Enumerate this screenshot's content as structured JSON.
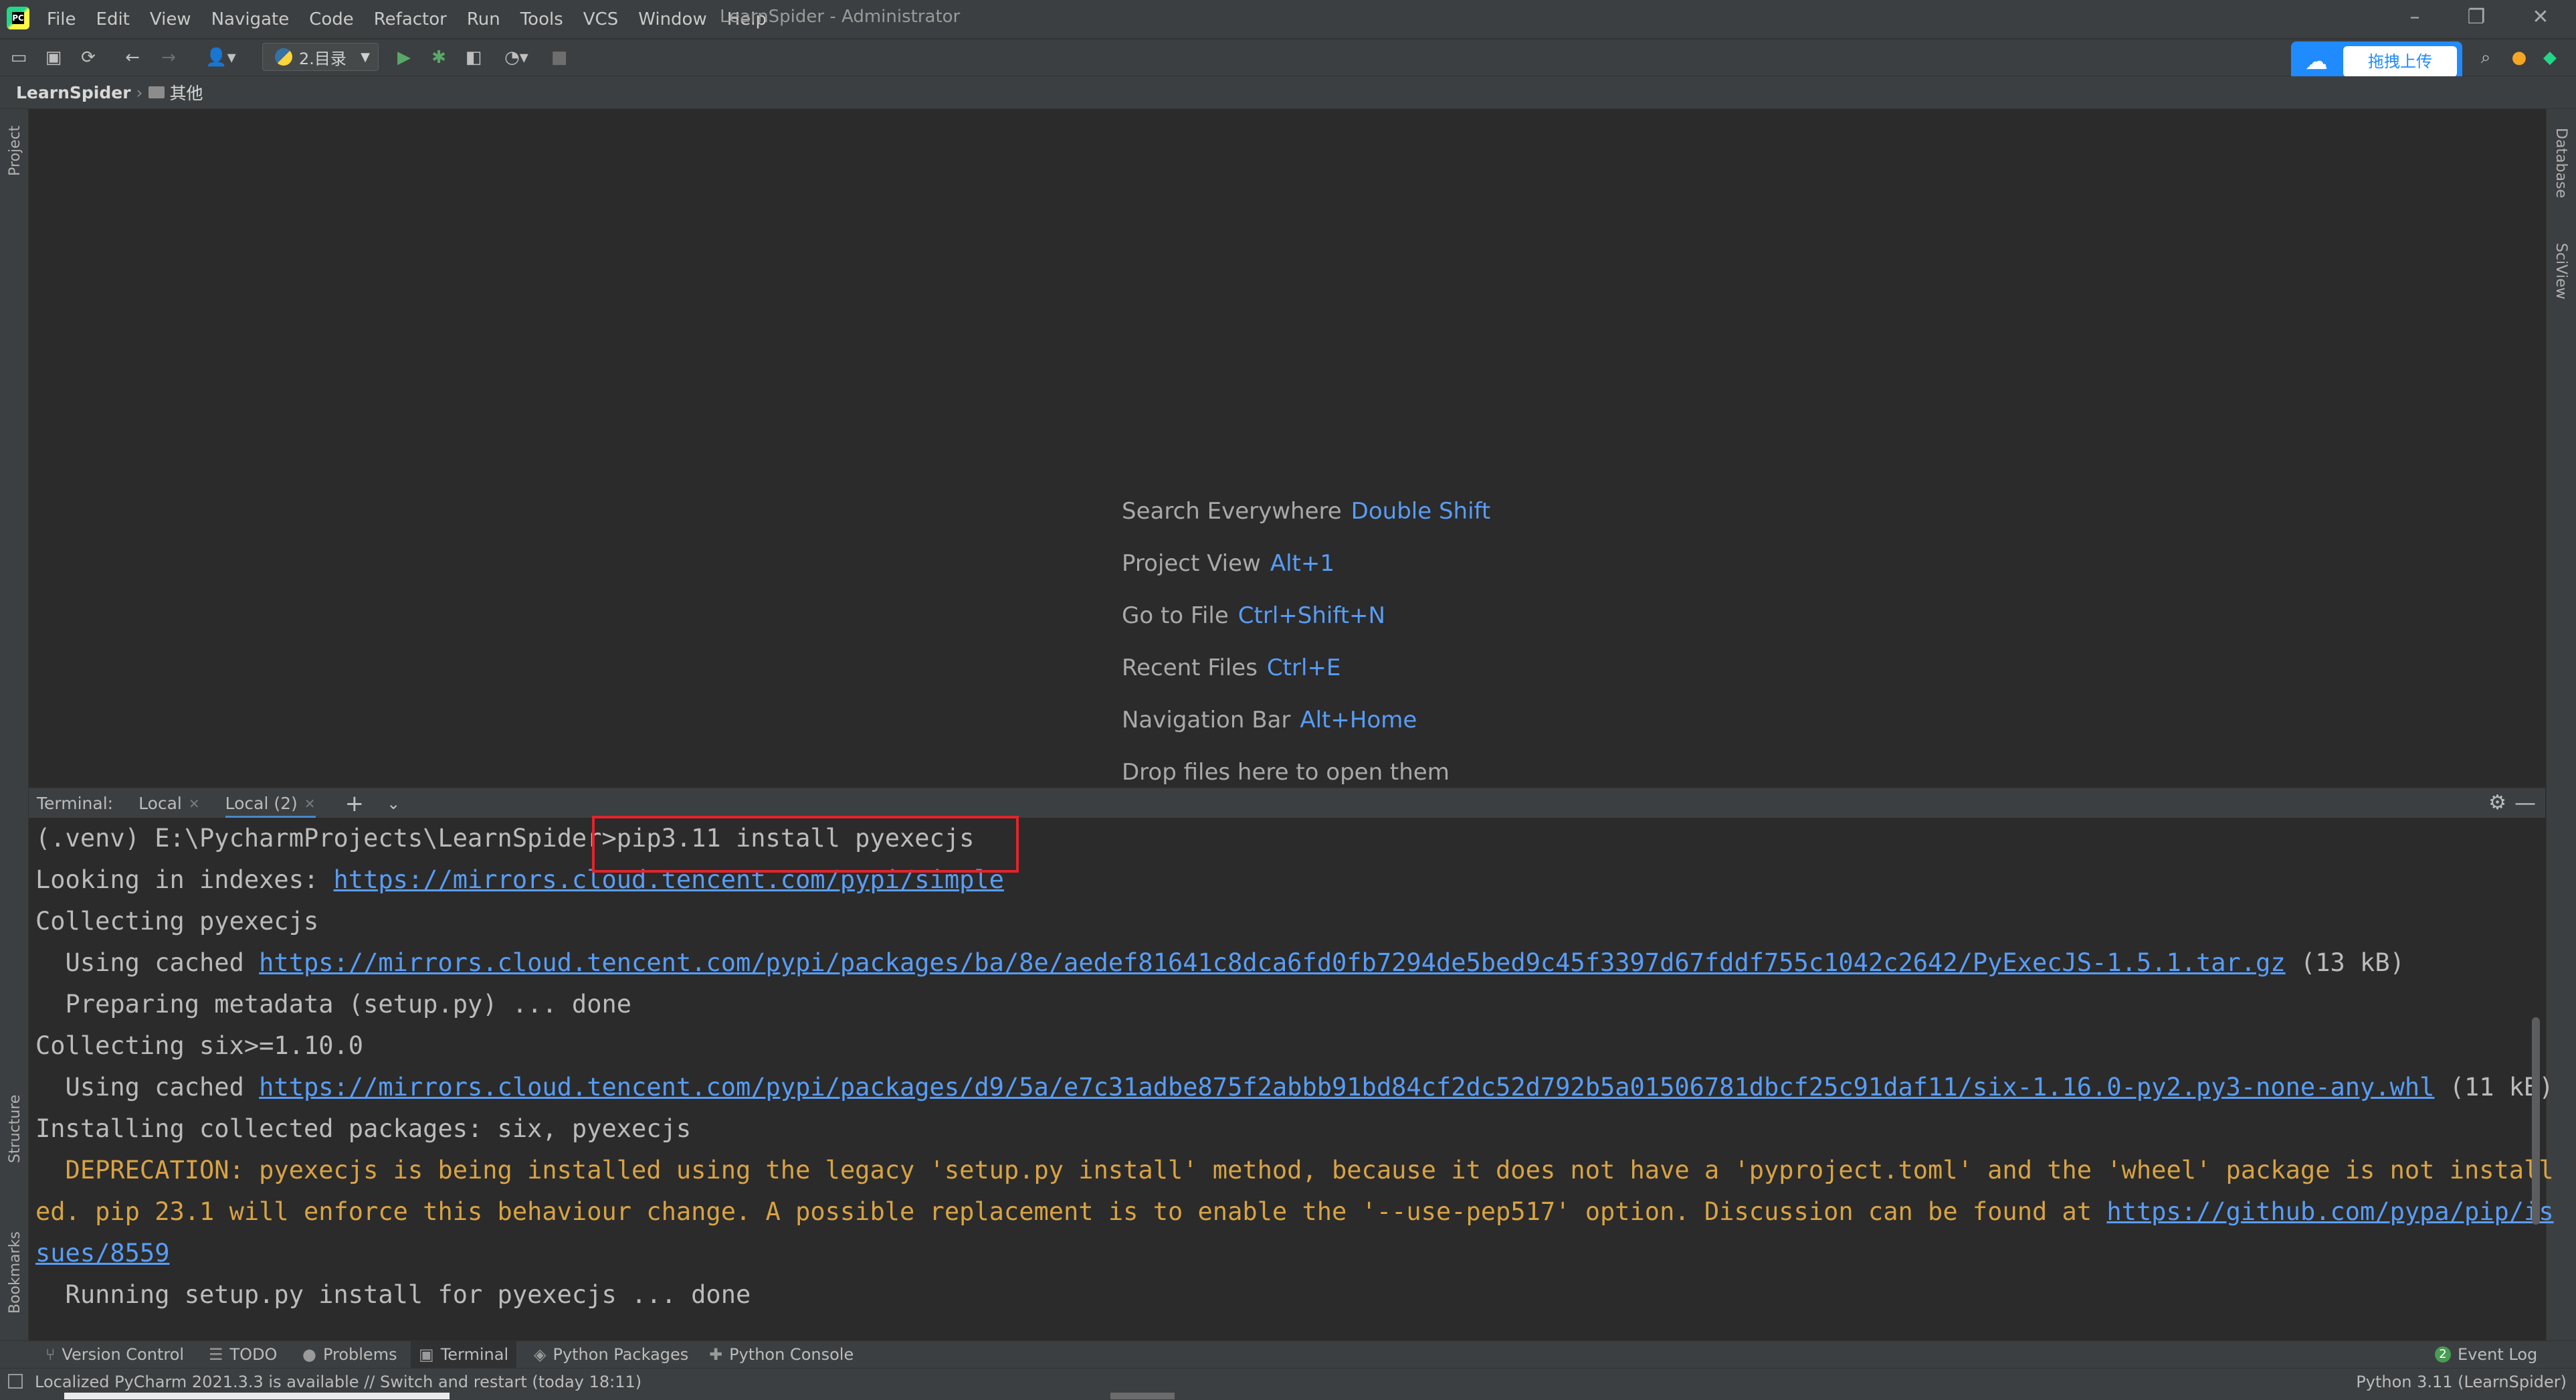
{
  "menu": {
    "items": [
      "File",
      "Edit",
      "View",
      "Navigate",
      "Code",
      "Refactor",
      "Run",
      "Tools",
      "VCS",
      "Window",
      "Help"
    ],
    "window_title": "LearnSpider - Administrator"
  },
  "toolbar": {
    "run_config": "2.目录",
    "upload_button": "拖拽上传"
  },
  "navbar": {
    "project": "LearnSpider",
    "folder": "其他"
  },
  "side": {
    "left": [
      "Project",
      "Structure",
      "Bookmarks"
    ],
    "right": [
      "Database",
      "SciView"
    ]
  },
  "editor": {
    "hints": [
      {
        "label": "Search Everywhere",
        "key": "Double Shift"
      },
      {
        "label": "Project View",
        "key": "Alt+1"
      },
      {
        "label": "Go to File",
        "key": "Ctrl+Shift+N"
      },
      {
        "label": "Recent Files",
        "key": "Ctrl+E"
      },
      {
        "label": "Navigation Bar",
        "key": "Alt+Home"
      }
    ],
    "drop_text": "Drop files here to open them"
  },
  "terminal": {
    "label": "Terminal:",
    "tabs": [
      "Local",
      "Local (2)"
    ],
    "prompt": "(.venv) E:\\PycharmProjects\\LearnSpider>",
    "command": "pip3.11 install pyexecjs",
    "line2_prefix": "Looking in indexes: ",
    "line2_link": "https://mirrors.cloud.tencent.com/pypi/simple",
    "line3": "Collecting pyexecjs",
    "line4_prefix": "  Using cached ",
    "line4_link": "https://mirrors.cloud.tencent.com/pypi/packages/ba/8e/aedef81641c8dca6fd0fb7294de5bed9c45f3397d67fddf755c1042c2642/PyExecJS-1.5.1.tar.gz",
    "line4_suffix": " (13 kB)",
    "line5": "  Preparing metadata (setup.py) ... done",
    "line6": "Collecting six>=1.10.0",
    "line7_prefix": "  Using cached ",
    "line7_link": "https://mirrors.cloud.tencent.com/pypi/packages/d9/5a/e7c31adbe875f2abbb91bd84cf2dc52d792b5a01506781dbcf25c91daf11/six-1.16.0-py2.py3-none-any.whl",
    "line7_suffix": " (11 kB)",
    "line8": "Installing collected packages: six, pyexecjs",
    "line9": "  DEPRECATION: pyexecjs is being installed using the legacy 'setup.py install' method, because it does not have a 'pyproject.toml' and the 'wheel' package is not install",
    "line10_text": "ed. pip 23.1 will enforce this behaviour change. A possible replacement is to enable the '--use-pep517' option. Discussion can be found at ",
    "line10_link": "https://github.com/pypa/pip/is",
    "line11_link": "sues/8559",
    "line12": "  Running setup.py install for pyexecjs ... done"
  },
  "bottom_tabs": [
    "Version Control",
    "TODO",
    "Problems",
    "Terminal",
    "Python Packages",
    "Python Console"
  ],
  "event_log": {
    "count": "2",
    "label": "Event Log"
  },
  "status": {
    "message": "Localized PyCharm 2021.3.3 is available // Switch and restart (today 18:11)",
    "interpreter": "Python 3.11 (LearnSpider)"
  }
}
